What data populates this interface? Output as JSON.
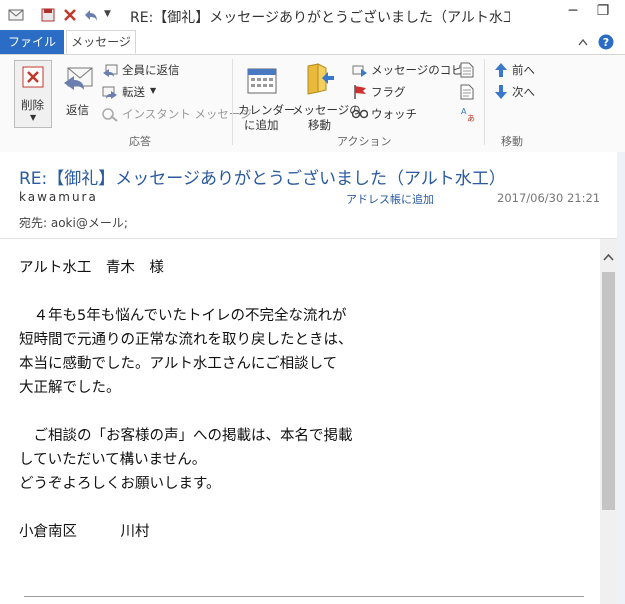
{
  "window": {
    "title": "RE:【御礼】メッセージありがとうございました（アルト水工）-...",
    "minimize": "─",
    "restore": "❐"
  },
  "tabs": {
    "file": "ファイル",
    "message": "メッセージ"
  },
  "ribbon": {
    "delete_label": "削除",
    "reply_label": "返信",
    "reply_all_label": "全員に返信",
    "forward_label": "転送",
    "instant_message_label": "インスタント メッセージ",
    "calendar_label_line1": "カレンダー",
    "calendar_label_line2": "に追加",
    "move_label_line1": "メッセージの",
    "move_label_line2": "移動",
    "copy_label": "メッセージのコピー",
    "flag_label": "フラグ",
    "watch_label": "ウォッチ",
    "prev_label": "前へ",
    "next_label": "次へ",
    "group_reply": "応答",
    "group_action": "アクション",
    "group_move": "移動"
  },
  "message": {
    "subject": "RE:【御礼】メッセージありがとうございました（アルト水工）",
    "sender": "kawamura",
    "address_book": "アドレス帳に追加",
    "datetime": "2017/06/30 21:21",
    "to": "宛先: aoki@メール;",
    "body": "アルト水工　青木　様\n\n　４年も5年も悩んでいたトイレの不完全な流れが\n短時間で元通りの正常な流れを取り戻したときは、\n本当に感動でした。アルト水工さんにご相談して\n大正解でした。\n\n　ご相談の「お客様の声」への掲載は、本名で掲載\nしていただいて構いません。\nどうぞよろしくお願いします。\n\n小倉南区　　　川村"
  },
  "colors": {
    "file_tab": "#2b6cc4",
    "subject": "#2a5aa0",
    "delete_x": "#c0392b"
  }
}
